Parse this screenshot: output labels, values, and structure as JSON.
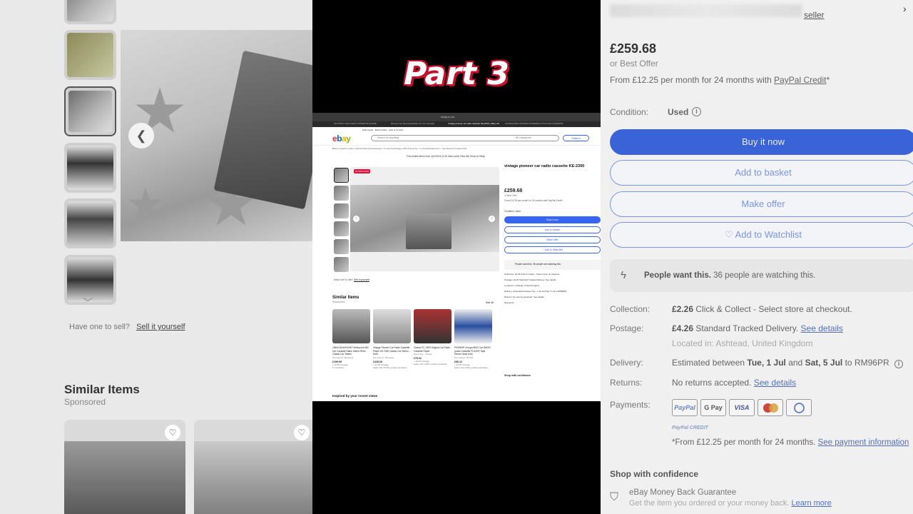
{
  "overlay": {
    "title": "Part 3"
  },
  "left_pane": {
    "have_one": "Have one to sell?",
    "sell_link": "Sell it yourself",
    "similar_title": "Similar Items",
    "sponsored": "Sponsored"
  },
  "screenshot": {
    "browser_url": "ebay.co.uk",
    "tabs": [
      "FIN FIRST CAR RADIO CASSETTE ALPINE",
      "Pioneer Car Receiver/Holder For '57 Cassette",
      "vintage pioneer car radio cassette KE-2300 | eBay UK",
      "ULTRA RARE VINTAGE PIONEER KP-575 CAR CASSETTE"
    ],
    "top_nav": [
      "Daily Deals",
      "Brand Outlet",
      "Help & Contact"
    ],
    "search_placeholder": "Search for anything",
    "category": "All Categories",
    "search_btn": "Search",
    "advanced": "Advanced",
    "breadcrumb": "Back to search results  |  Vehicle Parts & Accessories  >  In-Car Technology, GPS & Security  >  In-Car Entertainment  >  Car Stereos & Head Units",
    "store_bar": "Find similar items from  QUODO4 (3.9K items sold)   View this Shop on eBay",
    "sponsored_tag": "Sponsored",
    "badge": "36 WATCHED",
    "counter": "36",
    "sellit_prefix": "Have one to sell?",
    "sellit_link": "Sell it yourself",
    "similar_title": "Similar Items",
    "sponsored": "Sponsored",
    "see_all": "See all",
    "cards": [
      {
        "title": "1960s BLAUPUNKT Melbourne MN Car Cassette Radio Stereo Retro Classic Car Tested",
        "cond": "Pre-owned · Business",
        "price": "£199.99",
        "meta": "+ £4.95 Postage",
        "extra": "17 watchers"
      },
      {
        "title": "Vintage Pioneer Car Radio Cassette Player KE-2300 Classic Car Stereo - Rare",
        "cond": "Pre-owned · Business",
        "price": "£228.05",
        "meta": "+ £4.99 Postage",
        "extra": "Seller with 99.8% positive feedback"
      },
      {
        "title": "Classic PC-7805 Original Car Radio Cassette Player",
        "cond": "Parts only · Private",
        "price": "£79.22",
        "meta": "+ £4.29 Postage",
        "extra": "Seller with 100% positive feedback"
      },
      {
        "title": "PIONEER 2nd gen3000 Car RADIO (audio Cassette PLAYER Tape Stereo Head Unit)",
        "cond": "Pre-owned · Private",
        "price": "£50.12",
        "meta": "+ £4.25 Postage",
        "extra": "Seller with 100% positive feedback"
      }
    ],
    "inspired": "Inspired by your recent views",
    "rp": {
      "title": "vintage pioneer car radio cassette KE-2300",
      "price": "£259.68",
      "best_offer": "or Best Offer",
      "credit": "From £12.25 per month for 24 months with PayPal Credit*",
      "condition": "Condition:  Used",
      "buy_now": "Buy it now",
      "add_basket": "Add to basket",
      "make_offer": "Make offer",
      "watchlist": "♡ Add to Watchlist",
      "people_want": "People want this. 36 people are watching this.",
      "rows": [
        "Collection:   £2.26 Click & Collect - Select store at checkout.",
        "Postage:   £4.26 Standard Tracked Delivery. See details",
        "Located in: Ashtead, United Kingdom",
        "Delivery:   Estimated between Tue, 1 Jul and Sat, 5 Jul to RM96PR",
        "Returns:   No returns accepted. See details",
        "Payments:"
      ],
      "shop_conf": "Shop with confidence"
    }
  },
  "right_pane": {
    "seller": "seller",
    "price": "£259.68",
    "best_offer": "or Best Offer",
    "credit_prefix": "From £12.25 per month for 24 months with ",
    "credit_link": "PayPal Credit",
    "credit_suffix": "*",
    "condition_label": "Condition:",
    "condition_value": "Used",
    "buy_now": "Buy it now",
    "add_basket": "Add to basket",
    "make_offer": "Make offer",
    "watchlist": "♡ Add to Watchlist",
    "people_want_bold": "People want this.",
    "people_want_rest": " 36 people are watching this.",
    "collection_label": "Collection:",
    "collection_bold": "£2.26",
    "collection_rest": " Click & Collect - Select store at checkout.",
    "postage_label": "Postage:",
    "postage_bold": "£4.26",
    "postage_rest": " Standard Tracked Delivery. ",
    "postage_link": "See details",
    "located": "Located in: Ashtead, United Kingdom",
    "delivery_label": "Delivery:",
    "delivery_pre": "Estimated between ",
    "delivery_d1": "Tue, 1 Jul",
    "delivery_mid": " and ",
    "delivery_d2": "Sat, 5 Jul",
    "delivery_post": " to RM96PR",
    "returns_label": "Returns:",
    "returns_text": "No returns accepted. ",
    "returns_link": "See details",
    "payments_label": "Payments:",
    "payments": [
      "PayPal",
      "G Pay",
      "VISA",
      "",
      ""
    ],
    "paypal_credit_logo": "PayPal CREDIT",
    "pp_foot_prefix": "*From £12.25 per month for 24 months. ",
    "pp_foot_link": "See payment information",
    "shop_conf": "Shop with confidence",
    "mbg_title": "eBay Money Back Guarantee",
    "mbg_text": "Get the item you ordered or your money back. ",
    "mbg_link": "Learn more"
  }
}
